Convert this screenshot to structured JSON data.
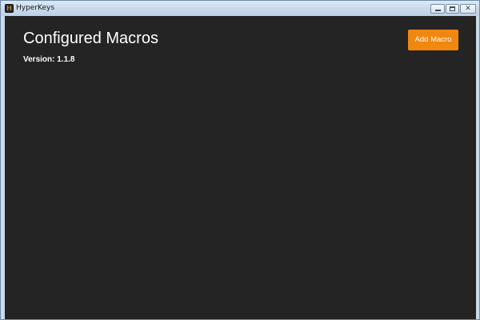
{
  "window": {
    "title": "HyperKeys",
    "app_icon_glyph": "H"
  },
  "window_controls": {
    "minimize_icon": "minimize-icon",
    "maximize_icon": "maximize-icon",
    "close_icon": "close-icon",
    "close_glyph": "✕"
  },
  "main": {
    "title": "Configured Macros",
    "version": "Version: 1.1.8",
    "add_button_label": "Add Macro"
  },
  "colors": {
    "background": "#242424",
    "accent": "#f0870f",
    "text": "#ffffff",
    "titlebar": "#c8d9ec"
  }
}
